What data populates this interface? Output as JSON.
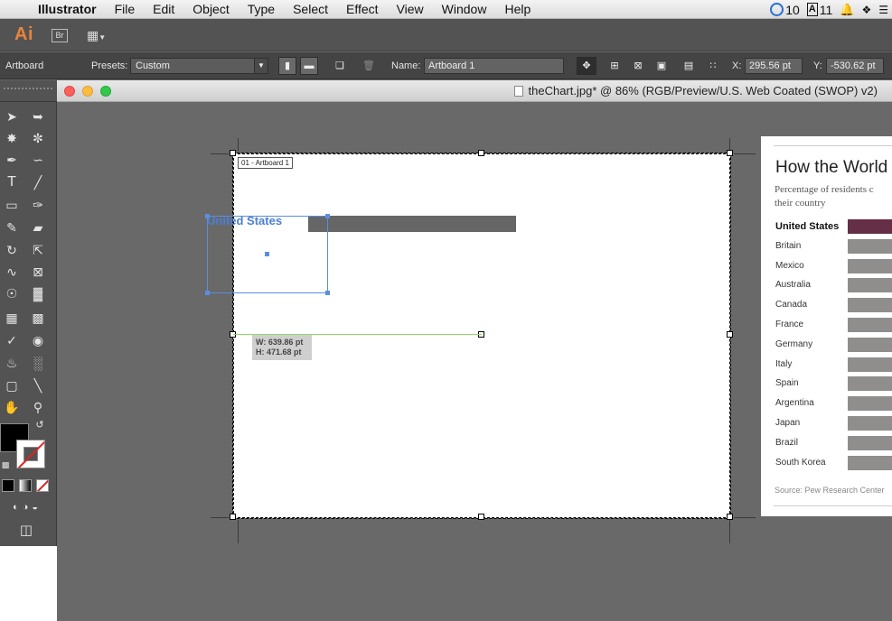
{
  "menubar": {
    "apple": "",
    "app_name": "Illustrator",
    "items": [
      "File",
      "Edit",
      "Object",
      "Type",
      "Select",
      "Effect",
      "View",
      "Window",
      "Help"
    ],
    "cc_count": "10",
    "adobe_count": "11"
  },
  "appbar": {
    "logo": "Ai",
    "bridge": "Br"
  },
  "controlbar": {
    "mode_label": "Artboard",
    "presets_label": "Presets:",
    "preset_value": "Custom",
    "name_label": "Name:",
    "name_value": "Artboard 1",
    "x_label": "X:",
    "x_value": "295.56 pt",
    "y_label": "Y:",
    "y_value": "-530.62 pt"
  },
  "document": {
    "title": "theChart.jpg* @ 86% (RGB/Preview/U.S. Web Coated (SWOP) v2)",
    "artboard_label": "01 - Artboard 1",
    "selected_text": "United States",
    "measure_w": "W: 639.86 pt",
    "measure_h": "H: 471.68 pt"
  },
  "reference_chart": {
    "title": "How the World",
    "subtitle_line1": "Percentage of residents c",
    "subtitle_line2": "their country",
    "rows": [
      {
        "label": "United States"
      },
      {
        "label": "Britain"
      },
      {
        "label": "Mexico"
      },
      {
        "label": "Australia"
      },
      {
        "label": "Canada"
      },
      {
        "label": "France"
      },
      {
        "label": "Germany"
      },
      {
        "label": "Italy"
      },
      {
        "label": "Spain"
      },
      {
        "label": "Argentina"
      },
      {
        "label": "Japan"
      },
      {
        "label": "Brazil"
      },
      {
        "label": "South Korea"
      }
    ],
    "source": "Source: Pew Research Center",
    "highlight_color": "#642f47",
    "bar_color": "#8f8e8c"
  },
  "colors": {
    "accent_selection": "#5b8de0",
    "guide": "#8fd66b",
    "ai_orange": "#e8843a"
  }
}
